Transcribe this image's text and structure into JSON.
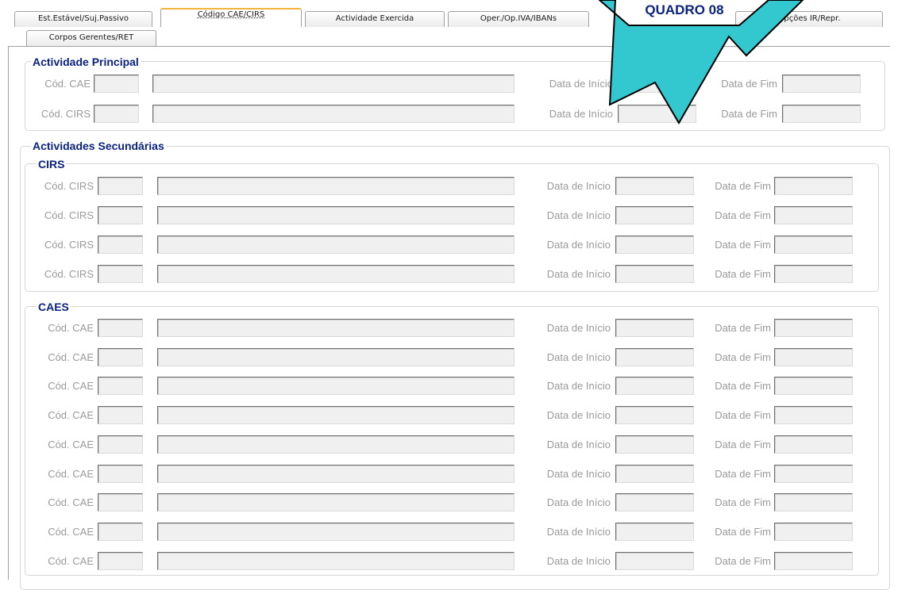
{
  "tabs": [
    {
      "label": "Est.Estável/Suj.Passivo",
      "active": false
    },
    {
      "label": "Código CAE/CIRS",
      "active": true
    },
    {
      "label": "Actividade Exercida",
      "active": false
    },
    {
      "label": "Oper./Op.IVA/IBANs",
      "active": false
    },
    {
      "label": "Opções IR/Repr.",
      "active": false
    },
    {
      "label": "Corpos Gerentes/RET",
      "active": false
    }
  ],
  "callout": {
    "label": "QUADRO 08",
    "fill_color": "#33c7cf",
    "outline_color": "#000000"
  },
  "principal": {
    "title": "Actividade Principal",
    "rows": [
      {
        "code_label": "Cód. CAE",
        "start_label": "Data de Início",
        "end_label": "Data de Fim"
      },
      {
        "code_label": "Cód. CIRS",
        "start_label": "Data de Início",
        "end_label": "Data de Fim"
      }
    ]
  },
  "secundarias": {
    "title": "Actividades Secundárias",
    "cirs": {
      "title": "CIRS",
      "rows": [
        {
          "code_label": "Cód. CIRS",
          "start_label": "Data de Início",
          "end_label": "Data de Fim"
        },
        {
          "code_label": "Cód. CIRS",
          "start_label": "Data de Início",
          "end_label": "Data de Fim"
        },
        {
          "code_label": "Cód. CIRS",
          "start_label": "Data de Início",
          "end_label": "Data de Fim"
        },
        {
          "code_label": "Cód. CIRS",
          "start_label": "Data de Início",
          "end_label": "Data de Fim"
        }
      ]
    },
    "caes": {
      "title": "CAES",
      "rows": [
        {
          "code_label": "Cód. CAE",
          "start_label": "Data de Início",
          "end_label": "Data de Fim"
        },
        {
          "code_label": "Cód. CAE",
          "start_label": "Data de Início",
          "end_label": "Data de Fim"
        },
        {
          "code_label": "Cód. CAE",
          "start_label": "Data de Início",
          "end_label": "Data de Fim"
        },
        {
          "code_label": "Cód. CAE",
          "start_label": "Data de Início",
          "end_label": "Data de Fim"
        },
        {
          "code_label": "Cód. CAE",
          "start_label": "Data de Início",
          "end_label": "Data de Fim"
        },
        {
          "code_label": "Cód. CAE",
          "start_label": "Data de Início",
          "end_label": "Data de Fim"
        },
        {
          "code_label": "Cód. CAE",
          "start_label": "Data de Início",
          "end_label": "Data de Fim"
        },
        {
          "code_label": "Cód. CAE",
          "start_label": "Data de Início",
          "end_label": "Data de Fim"
        },
        {
          "code_label": "Cód. CAE",
          "start_label": "Data de Início",
          "end_label": "Data de Fim"
        }
      ]
    }
  }
}
